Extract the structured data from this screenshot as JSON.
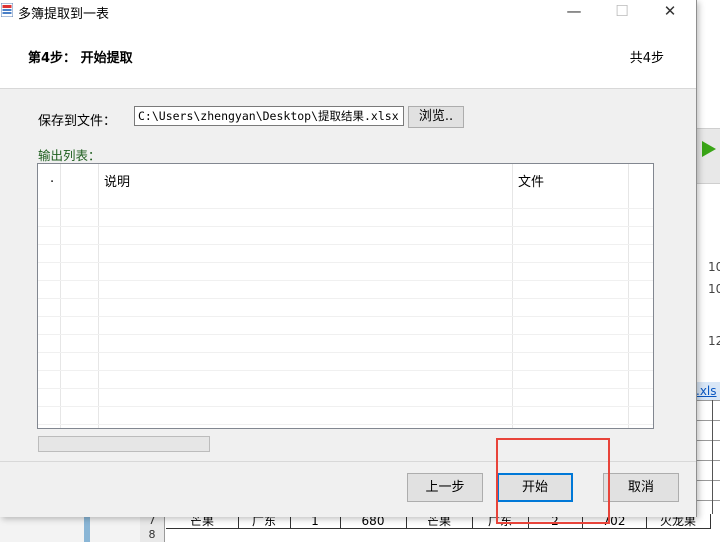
{
  "window": {
    "title": "多簿提取到一表",
    "minimize_glyph": "—",
    "maximize_glyph": "☐",
    "close_glyph": "✕"
  },
  "header": {
    "step_title": "第4步：  开始提取",
    "step_count": "共4步"
  },
  "save": {
    "label": "保存到文件：",
    "path_value": "C:\\Users\\zhengyan\\Desktop\\提取结果.xlsx",
    "browse_label": "浏览.."
  },
  "output_list": {
    "label": "输出列表：",
    "columns": [
      ".",
      "",
      "说明",
      "文件",
      ""
    ],
    "rows": []
  },
  "progress": {
    "value": 0
  },
  "footer": {
    "prev_label": "上一步",
    "start_label": "开始",
    "cancel_label": "取消"
  },
  "background": {
    "nums": [
      "10",
      "10",
      "12"
    ],
    "link_text": ".xls",
    "row_headers": [
      "7",
      "8"
    ],
    "cells": [
      "芒果",
      "广东",
      "1",
      "680",
      "芒果",
      "广东",
      "2",
      "702",
      "火龙果"
    ]
  },
  "colors": {
    "highlight": "#e8443a",
    "primary_border": "#0078d7",
    "list_label": "#1e5e1e"
  }
}
